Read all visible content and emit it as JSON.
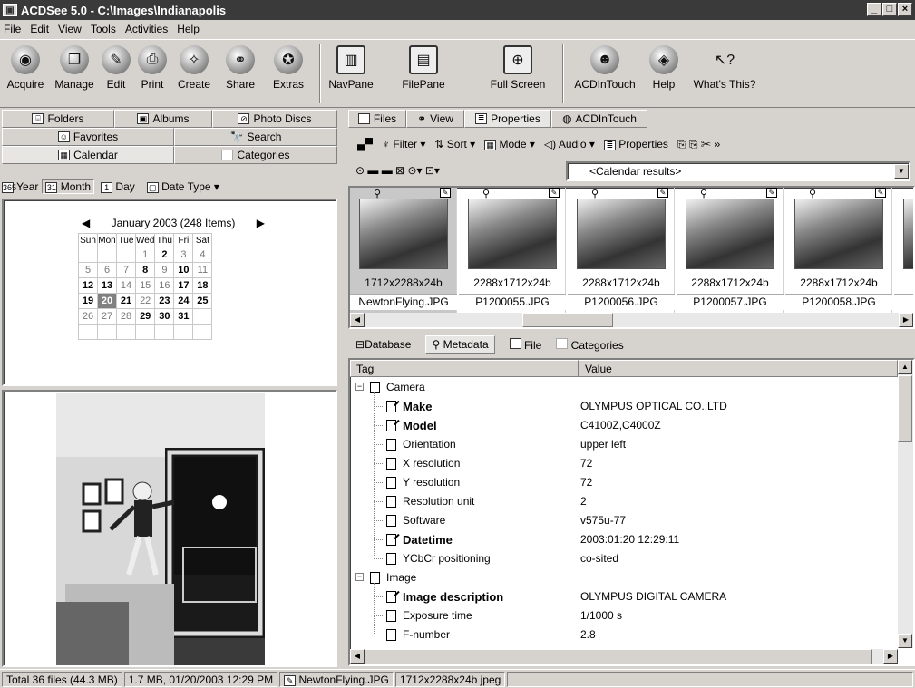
{
  "window": {
    "title": "ACDSee 5.0 - C:\\Images\\Indianapolis"
  },
  "menu": [
    "File",
    "Edit",
    "View",
    "Tools",
    "Activities",
    "Help"
  ],
  "toolbar": {
    "left": [
      {
        "label": "Acquire",
        "icon": "acquire-icon"
      },
      {
        "label": "Manage",
        "icon": "manage-icon"
      },
      {
        "label": "Edit",
        "icon": "edit-icon"
      },
      {
        "label": "Print",
        "icon": "print-icon"
      },
      {
        "label": "Create",
        "icon": "create-icon"
      },
      {
        "label": "Share",
        "icon": "share-icon"
      },
      {
        "label": "Extras",
        "icon": "extras-icon"
      }
    ],
    "right": [
      {
        "label": "NavPane",
        "icon": "navpane-icon"
      },
      {
        "label": "FilePane",
        "icon": "filepane-icon"
      },
      {
        "label": "Full Screen",
        "icon": "fullscreen-icon"
      },
      {
        "label": "ACDInTouch",
        "icon": "acdintouch-icon"
      },
      {
        "label": "Help",
        "icon": "help-icon"
      },
      {
        "label": "What's This?",
        "icon": "whats-this-icon"
      }
    ]
  },
  "nav_tabs": {
    "row1": [
      "Folders",
      "Albums",
      "Photo Discs"
    ],
    "row2": [
      "Favorites",
      "Search"
    ],
    "row3": [
      "Calendar",
      "Categories"
    ]
  },
  "calendar_toolbar": {
    "year": "Year",
    "month": "Month",
    "day": "Day",
    "date_type": "Date Type"
  },
  "calendar": {
    "header": "January 2003 (248 Items)",
    "weekdays": [
      "Sun",
      "Mon",
      "Tue",
      "Wed",
      "Thu",
      "Fri",
      "Sat"
    ],
    "weeks": [
      [
        "",
        "",
        "",
        "1",
        "2",
        "3",
        "4"
      ],
      [
        "5",
        "6",
        "7",
        "8",
        "9",
        "10",
        "11"
      ],
      [
        "12",
        "13",
        "14",
        "15",
        "16",
        "17",
        "18"
      ],
      [
        "19",
        "20",
        "21",
        "22",
        "23",
        "24",
        "25"
      ],
      [
        "26",
        "27",
        "28",
        "29",
        "30",
        "31",
        ""
      ]
    ],
    "bold_days": [
      "2",
      "8",
      "10",
      "12",
      "13",
      "17",
      "18",
      "19",
      "21",
      "23",
      "24",
      "25",
      "29",
      "30",
      "31"
    ],
    "selected_day": "20"
  },
  "file_tabs": [
    "Files",
    "View",
    "Properties",
    "ACDInTouch"
  ],
  "file_toolbar": {
    "filter": "Filter",
    "sort": "Sort",
    "mode": "Mode",
    "audio": "Audio",
    "properties": "Properties"
  },
  "location": "<Calendar results>",
  "thumbnails": [
    {
      "dims": "1712x2288x24b",
      "name": "NewtonFlying.JPG"
    },
    {
      "dims": "2288x1712x24b",
      "name": "P1200055.JPG"
    },
    {
      "dims": "2288x1712x24b",
      "name": "P1200056.JPG"
    },
    {
      "dims": "2288x1712x24b",
      "name": "P1200057.JPG"
    },
    {
      "dims": "2288x1712x24b",
      "name": "P1200058.JPG"
    },
    {
      "dims": "22",
      "name": "P"
    }
  ],
  "prop_tabs": [
    "Database",
    "Metadata",
    "File",
    "Categories"
  ],
  "metadata": {
    "col_tag": "Tag",
    "col_value": "Value",
    "groups": [
      {
        "name": "Camera",
        "rows": [
          {
            "tag": "Make",
            "value": "OLYMPUS OPTICAL CO.,LTD",
            "bold": true
          },
          {
            "tag": "Model",
            "value": "C4100Z,C4000Z",
            "bold": true
          },
          {
            "tag": "Orientation",
            "value": "upper left",
            "bold": false
          },
          {
            "tag": "X resolution",
            "value": "72",
            "bold": false
          },
          {
            "tag": "Y resolution",
            "value": "72",
            "bold": false
          },
          {
            "tag": "Resolution unit",
            "value": "2",
            "bold": false
          },
          {
            "tag": "Software",
            "value": "v575u-77",
            "bold": false
          },
          {
            "tag": "Datetime",
            "value": "2003:01:20 12:29:11",
            "bold": true
          },
          {
            "tag": "YCbCr positioning",
            "value": "co-sited",
            "bold": false
          }
        ]
      },
      {
        "name": "Image",
        "rows": [
          {
            "tag": "Image description",
            "value": "OLYMPUS DIGITAL CAMERA",
            "bold": true
          },
          {
            "tag": "Exposure time",
            "value": "1/1000 s",
            "bold": false
          },
          {
            "tag": "F-number",
            "value": "2.8",
            "bold": false
          }
        ]
      }
    ]
  },
  "status": {
    "total": "Total 36 files (44.3 MB)",
    "size_date": "1.7 MB, 01/20/2003 12:29 PM",
    "filename": "NewtonFlying.JPG",
    "info": "1712x2288x24b jpeg"
  }
}
